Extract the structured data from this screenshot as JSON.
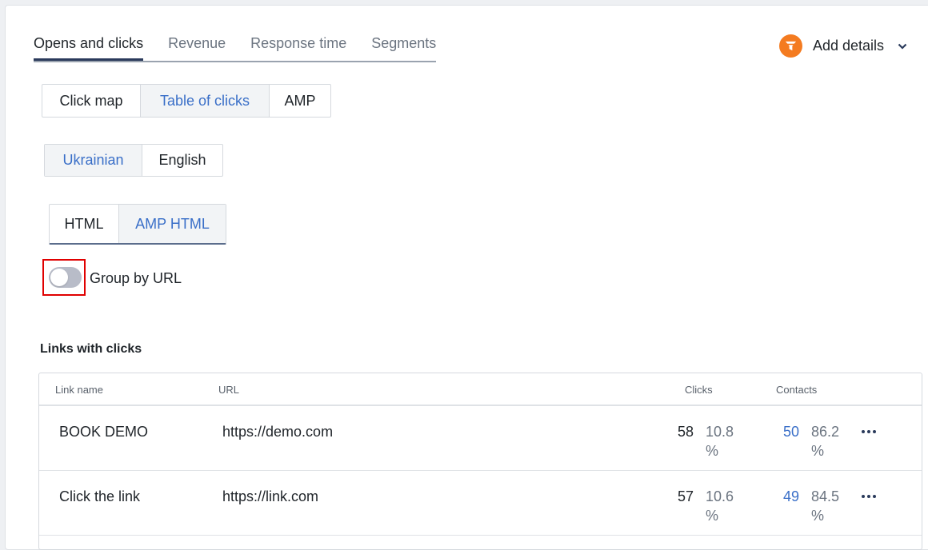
{
  "top_tabs": [
    {
      "label": "Opens and clicks",
      "active": true
    },
    {
      "label": "Revenue"
    },
    {
      "label": "Response time"
    },
    {
      "label": "Segments"
    }
  ],
  "add_details": {
    "label": "Add details",
    "icon": "funnel-icon",
    "icon_color": "#f47b20"
  },
  "view_switch": {
    "options": [
      "Click map",
      "Table of clicks",
      "AMP"
    ],
    "selected": "Table of clicks"
  },
  "language_switch": {
    "options": [
      "Ukrainian",
      "English"
    ],
    "selected": "Ukrainian"
  },
  "format_switch": {
    "options": [
      "HTML",
      "AMP HTML"
    ],
    "selected": "AMP HTML"
  },
  "group_toggle": {
    "label": "Group by URL",
    "on": false
  },
  "links_section": {
    "title": "Links with clicks",
    "columns": {
      "link_name": "Link name",
      "url": "URL",
      "clicks": "Clicks",
      "contacts": "Contacts"
    },
    "rows": [
      {
        "name": "BOOK DEMO",
        "url": "https://demo.com",
        "clicks": "58",
        "clicks_pct_value": "10.8",
        "clicks_pct_unit": "%",
        "contacts": "50",
        "contacts_pct_value": "86.2",
        "contacts_pct_unit": "%"
      },
      {
        "name": "Click the link",
        "url": "https://link.com",
        "clicks": "57",
        "clicks_pct_value": "10.6",
        "clicks_pct_unit": "%",
        "contacts": "49",
        "contacts_pct_value": "84.5",
        "contacts_pct_unit": "%"
      }
    ]
  },
  "colors": {
    "accent": "#3a6fc8",
    "highlight": "#e00000",
    "brand_orange": "#f47b20"
  }
}
